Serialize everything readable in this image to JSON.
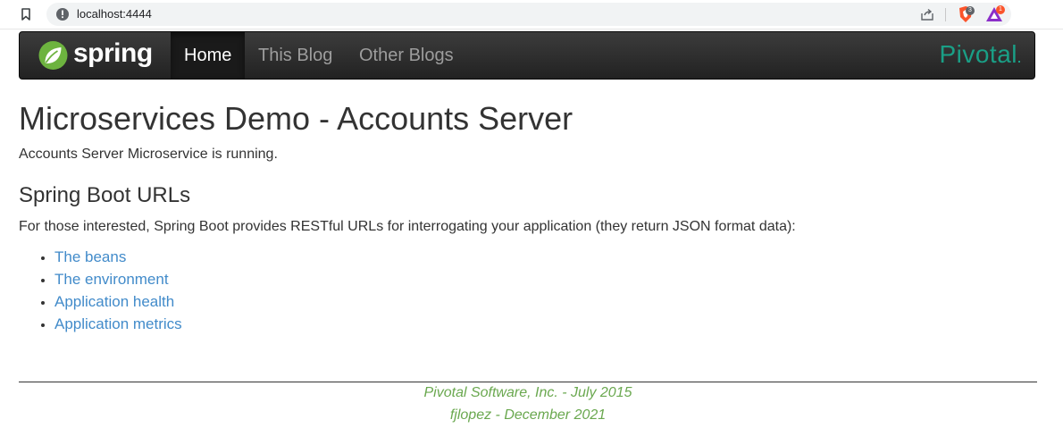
{
  "browser": {
    "url": "localhost:4444",
    "shield_badge": "3",
    "rewards_badge": "1"
  },
  "navbar": {
    "brand": "spring",
    "items": [
      {
        "label": "Home",
        "active": true
      },
      {
        "label": "This Blog",
        "active": false
      },
      {
        "label": "Other Blogs",
        "active": false
      }
    ],
    "partner_logo": "Pivotal"
  },
  "main": {
    "title": "Microservices Demo - Accounts Server",
    "status": "Accounts Server Microservice is running.",
    "section_heading": "Spring Boot URLs",
    "intro": "For those interested, Spring Boot provides RESTful URLs for interrogating your application (they return JSON format data):",
    "links": [
      {
        "label": "The beans"
      },
      {
        "label": "The environment"
      },
      {
        "label": "Application health"
      },
      {
        "label": "Application metrics"
      }
    ]
  },
  "footer": {
    "line1": "Pivotal Software, Inc. - July 2015",
    "line2": "fjlopez - December 2021"
  },
  "colors": {
    "link": "#428bca",
    "footer_text": "#6aa84f",
    "pivotal_green": "#1a9f86",
    "spring_green": "#6db33f",
    "navbar_dark": "#222222"
  },
  "icons": {
    "bookmark": "bookmark-icon",
    "info": "info-icon",
    "share": "share-icon",
    "brave_shield": "brave-shield-icon",
    "brave_rewards": "brave-rewards-icon",
    "spring_leaf": "spring-leaf-icon"
  }
}
